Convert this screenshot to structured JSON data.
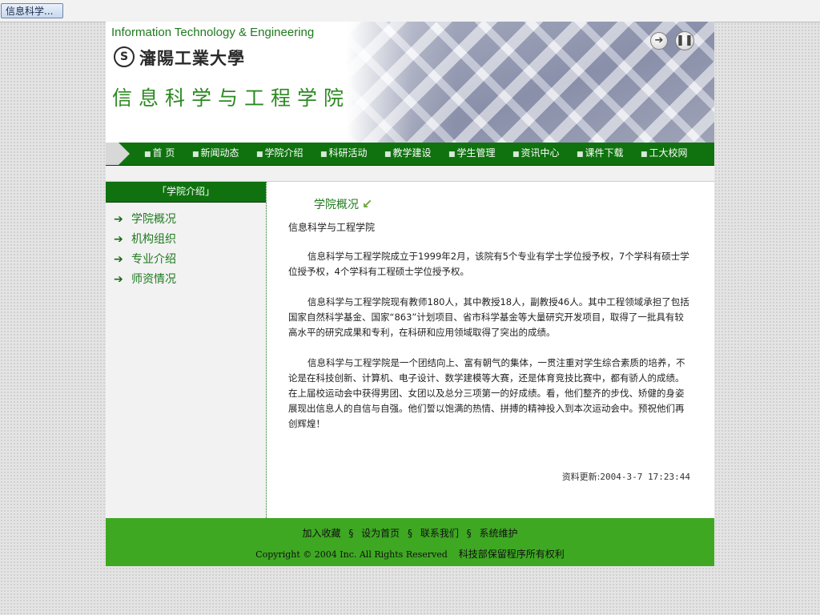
{
  "taskbar": {
    "task_label": "信息科学..."
  },
  "banner": {
    "tagline": "Information Technology & Engineering",
    "university_name": "瀋陽工業大學",
    "school_name": "信息科学与工程学院",
    "next_icon": "arrow-right-circle-icon",
    "pause_icon": "pause-circle-icon"
  },
  "nav": {
    "items": [
      "首 页",
      "新闻动态",
      "学院介绍",
      "科研活动",
      "教学建设",
      "学生管理",
      "资讯中心",
      "课件下载",
      "工大校网"
    ]
  },
  "sidebar": {
    "title": "「学院介绍」",
    "items": [
      "学院概况",
      "机构组织",
      "专业介绍",
      "师资情况"
    ]
  },
  "content": {
    "title": "学院概况",
    "subtitle": "信息科学与工程学院",
    "paragraphs": [
      "信息科学与工程学院成立于1999年2月，该院有5个专业有学士学位授予权，7个学科有硕士学位授予权，4个学科有工程硕士学位授予权。",
      "信息科学与工程学院现有教师180人，其中教授18人，副教授46人。其中工程领域承担了包括国家自然科学基金、国家“863”计划项目、省市科学基金等大量研究开发项目，取得了一批具有较高水平的研究成果和专利，在科研和应用领域取得了突出的成绩。",
      "信息科学与工程学院是一个团结向上、富有朝气的集体，一贯注重对学生综合素质的培养，不论是在科技创新、计算机、电子设计、数学建模等大赛，还是体育竞技比赛中，都有骄人的成绩。在上届校运动会中获得男团、女团以及总分三项第一的好成绩。看，他们整齐的步伐、矫健的身姿展现出信息人的自信与自强。他们誓以饱满的热情、拼搏的精神投入到本次运动会中。预祝他们再创辉煌！"
    ],
    "updated_label": "资料更新:",
    "updated_value": "2004-3-7 17:23:44"
  },
  "footer": {
    "links": [
      "加入收藏",
      "设为首页",
      "联系我们",
      "系统维护"
    ],
    "separator": "§",
    "copyright": "Copyright © 2004 Inc. All Rights Reserved",
    "owner": "科技部保留程序所有权利"
  },
  "colors": {
    "nav_green": "#0f720f",
    "footer_green": "#3ea822",
    "link_green": "#1e7a1e"
  }
}
